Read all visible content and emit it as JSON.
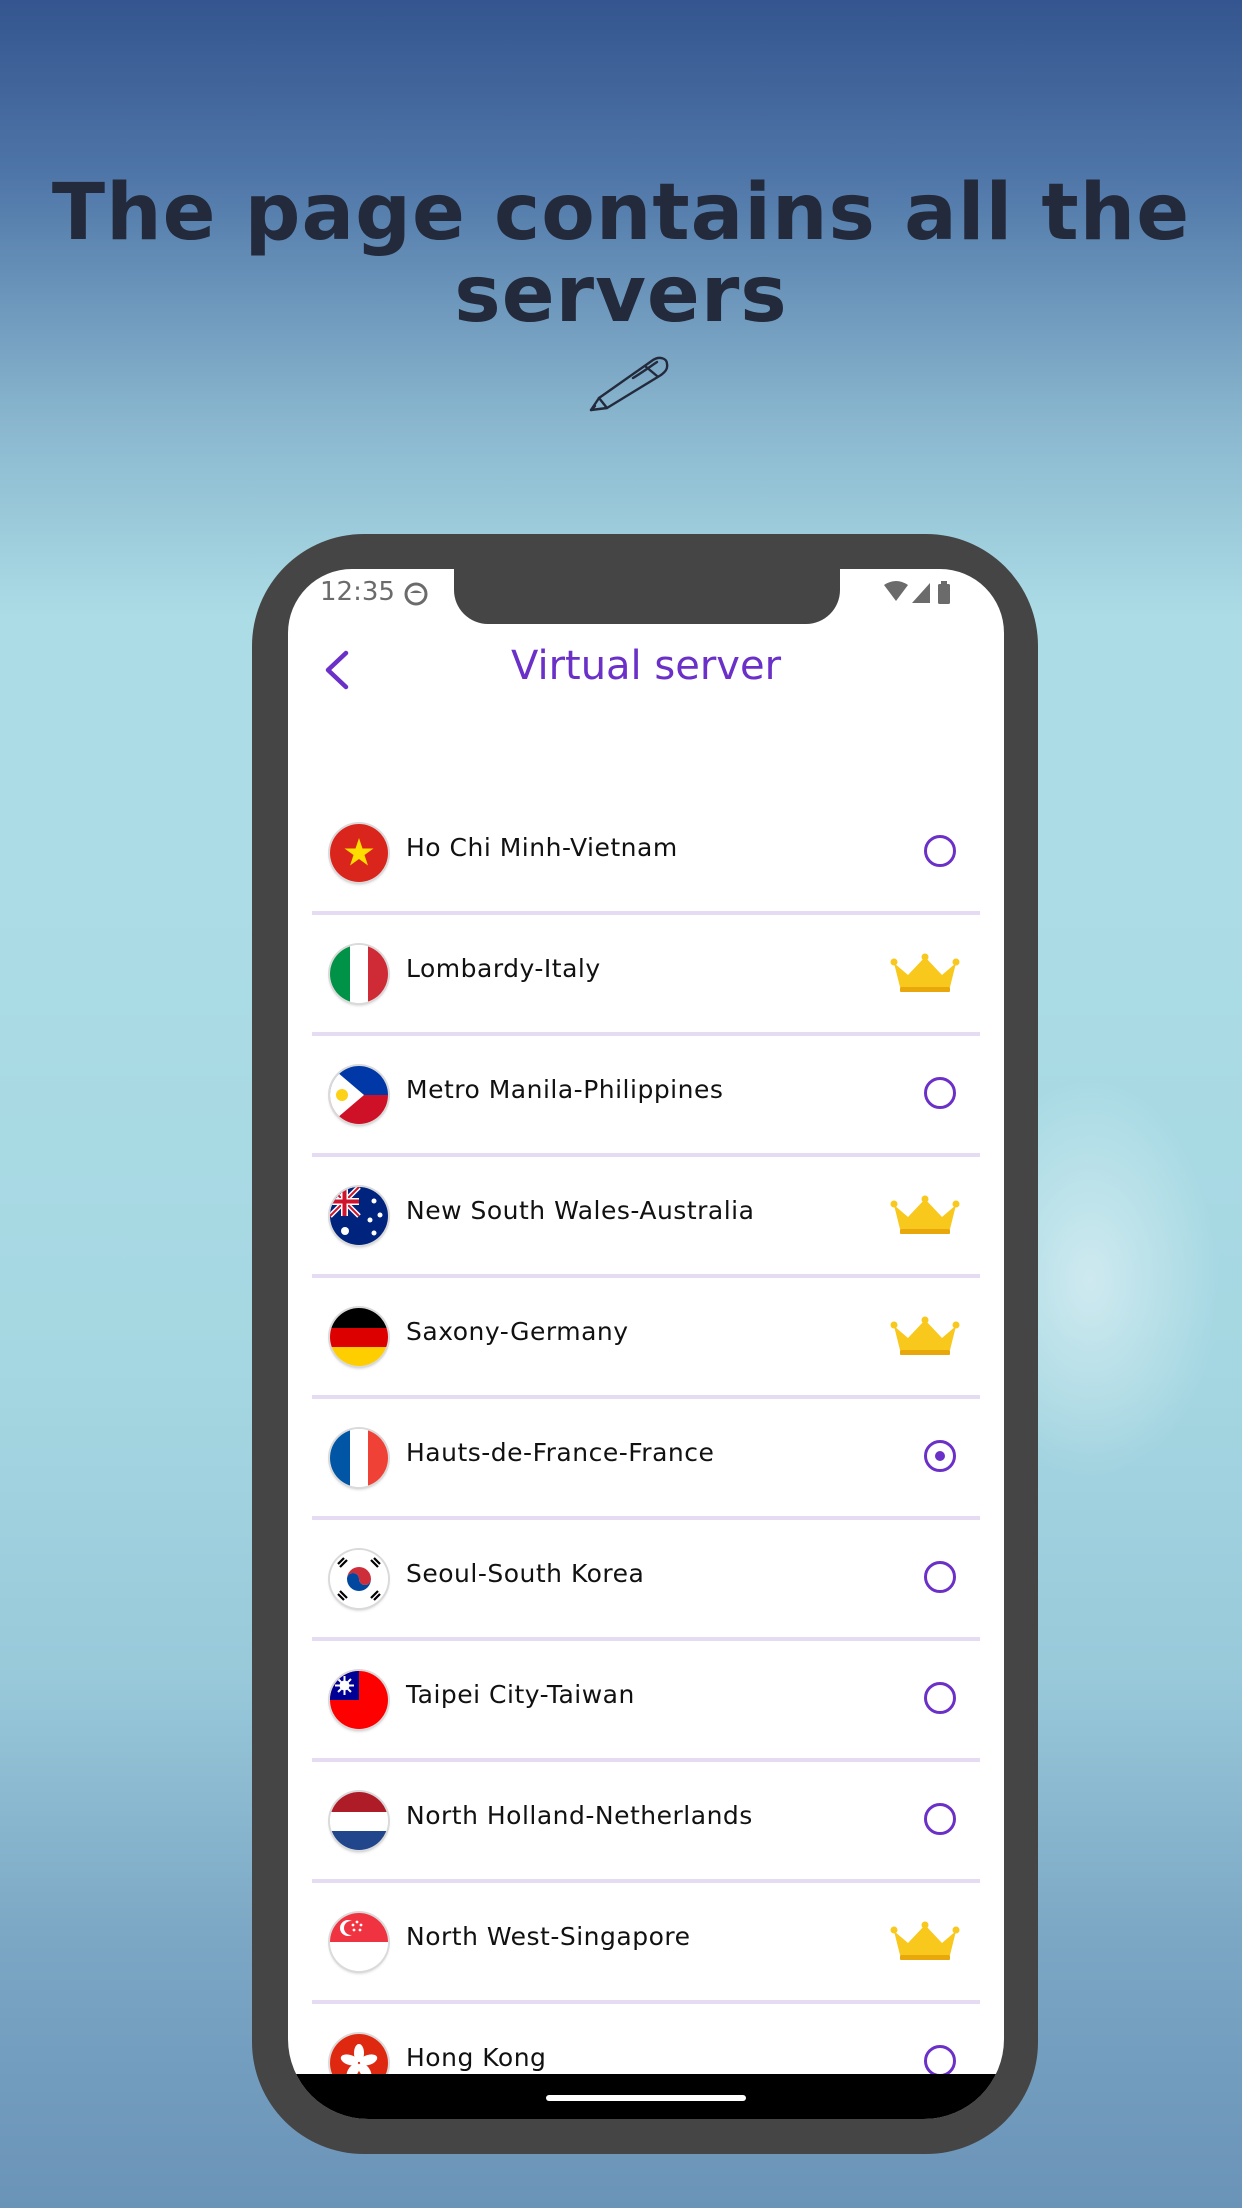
{
  "headline": "The page contains all the servers",
  "status_bar": {
    "time": "12:35"
  },
  "header": {
    "title": "Virtual server"
  },
  "colors": {
    "accent": "#6a30c8",
    "divider": "#e5dcf3",
    "crown": "#f8c81c"
  },
  "servers": [
    {
      "name": "Ho Chi Minh-Vietnam",
      "flag": "vietnam-flag-icon",
      "type": "radio",
      "selected": false
    },
    {
      "name": "Lombardy-Italy",
      "flag": "italy-flag-icon",
      "type": "premium",
      "selected": false
    },
    {
      "name": "Metro Manila-Philippines",
      "flag": "philippines-flag-icon",
      "type": "radio",
      "selected": false
    },
    {
      "name": "New South Wales-Australia",
      "flag": "australia-flag-icon",
      "type": "premium",
      "selected": false
    },
    {
      "name": "Saxony-Germany",
      "flag": "germany-flag-icon",
      "type": "premium",
      "selected": false
    },
    {
      "name": "Hauts-de-France-France",
      "flag": "france-flag-icon",
      "type": "radio",
      "selected": true
    },
    {
      "name": "Seoul-South Korea",
      "flag": "south-korea-flag-icon",
      "type": "radio",
      "selected": false
    },
    {
      "name": "Taipei City-Taiwan",
      "flag": "taiwan-flag-icon",
      "type": "radio",
      "selected": false
    },
    {
      "name": "North Holland-Netherlands",
      "flag": "netherlands-flag-icon",
      "type": "radio",
      "selected": false
    },
    {
      "name": "North West-Singapore",
      "flag": "singapore-flag-icon",
      "type": "premium",
      "selected": false
    },
    {
      "name": "Hong Kong",
      "flag": "hong-kong-flag-icon",
      "type": "radio",
      "selected": false
    }
  ]
}
